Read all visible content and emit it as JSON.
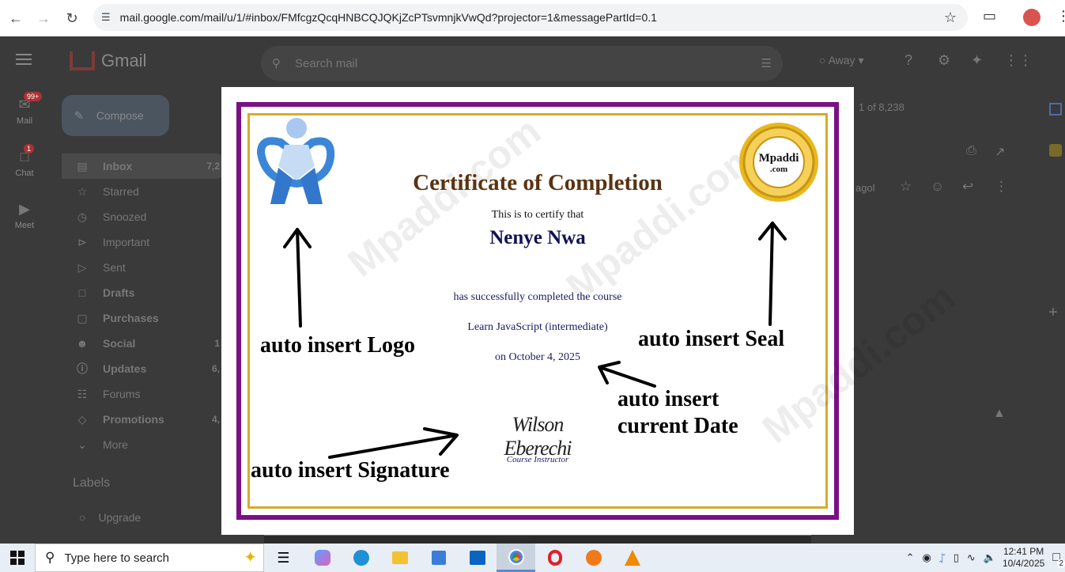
{
  "browser": {
    "url": "mail.google.com/mail/u/1/#inbox/FMfcgzQcqHNBCQJQKjZcPTsvmnjkVwQd?projector=1&messagePartId=0.1"
  },
  "gmail": {
    "app_name": "Gmail",
    "search_placeholder": "Search mail",
    "status": "Away",
    "compose_label": "Compose",
    "rail": [
      {
        "label": "Mail",
        "badge": "99+"
      },
      {
        "label": "Chat",
        "badge": "1"
      },
      {
        "label": "Meet",
        "badge": ""
      }
    ],
    "folders": [
      {
        "label": "Inbox",
        "count": "7,2",
        "icon": "inbox-icon"
      },
      {
        "label": "Starred",
        "count": "",
        "icon": "star-icon"
      },
      {
        "label": "Snoozed",
        "count": "",
        "icon": "clock-icon"
      },
      {
        "label": "Important",
        "count": "",
        "icon": "important-icon"
      },
      {
        "label": "Sent",
        "count": "",
        "icon": "send-icon"
      },
      {
        "label": "Drafts",
        "count": "",
        "icon": "draft-icon"
      },
      {
        "label": "Purchases",
        "count": "",
        "icon": "bag-icon"
      },
      {
        "label": "Social",
        "count": "1",
        "icon": "people-icon"
      },
      {
        "label": "Updates",
        "count": "6,",
        "icon": "info-icon"
      },
      {
        "label": "Forums",
        "count": "",
        "icon": "forum-icon"
      },
      {
        "label": "Promotions",
        "count": "4,",
        "icon": "tag-icon"
      },
      {
        "label": "More",
        "count": "",
        "icon": "chevron-down-icon"
      }
    ],
    "labels_header": "Labels",
    "upgrade_label": "Upgrade",
    "pagination": "1 of 8,238",
    "time_ago": "agol"
  },
  "certificate": {
    "title": "Certificate of Completion",
    "certify_text": "This is to certify that",
    "recipient": "Nenye Nwa",
    "completed_text": "has successfully completed the course",
    "course": "Learn JavaScript (intermediate)",
    "date_text": "on October 4, 2025",
    "signature": "Wilson Eberechi",
    "signer_role": "Course Instructor",
    "seal_brand": "Mpaddi",
    "seal_domain": ".com",
    "watermark": "Mpaddi.com",
    "border_color": "#7b0f86",
    "gold_color": "#d4ac2f"
  },
  "annotations": {
    "logo": "auto insert Logo",
    "seal": "auto insert Seal",
    "date_line1": "auto insert",
    "date_line2": "current Date",
    "signature": "auto insert Signature"
  },
  "taskbar": {
    "search_placeholder": "Type here to search",
    "time": "12:41 PM",
    "date": "10/4/2025",
    "notifications": "2"
  }
}
